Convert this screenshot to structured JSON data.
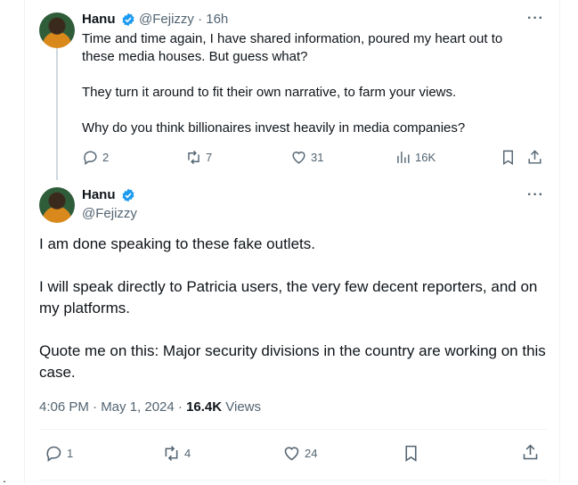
{
  "reply_tweet": {
    "author_name": "Hanu",
    "handle": "@Fejizzy",
    "time": "· 16h",
    "more": "···",
    "paragraphs": [
      "Time and time again, I have shared information, poured my heart out to these media houses. But guess what?",
      "They turn it around to fit their own narrative, to farm your views.",
      "Why do you think billionaires invest heavily in media companies?"
    ],
    "actions": {
      "replies": "2",
      "reposts": "7",
      "likes": "31",
      "views": "16K"
    }
  },
  "main_tweet": {
    "author_name": "Hanu",
    "handle": "@Fejizzy",
    "more": "···",
    "paragraphs": [
      "I am done speaking to these fake outlets.",
      "I will speak directly to Patricia users, the very few decent reporters, and on my platforms.",
      "Quote me on this: Major security divisions in the country are working on this case."
    ],
    "timestamp": "4:06 PM · May 1, 2024 · ",
    "views_count": "16.4K",
    "views_label": " Views",
    "actions": {
      "replies": "1",
      "reposts": "4",
      "likes": "24"
    }
  },
  "stray_mark": "."
}
